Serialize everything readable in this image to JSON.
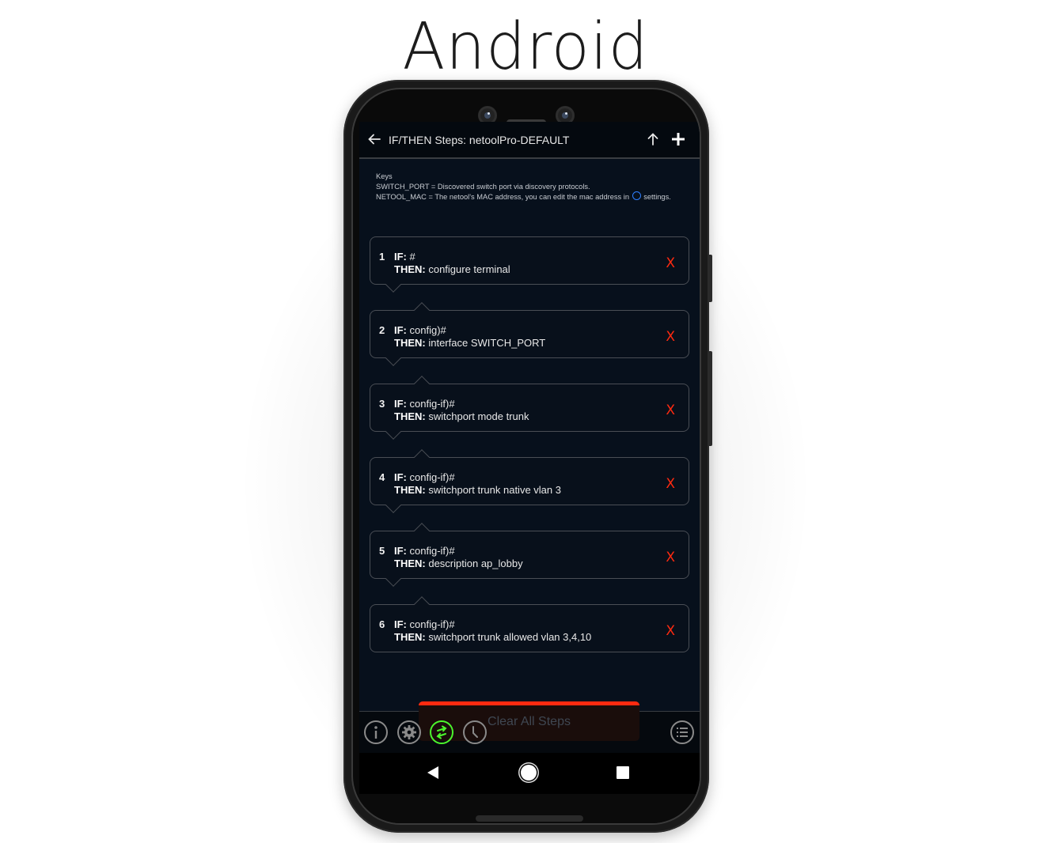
{
  "headline": "Android",
  "app": {
    "title": "IF/THEN Steps: netoolPro-DEFAULT",
    "icons": {
      "back": "arrow-left-icon",
      "upload": "arrow-up-icon",
      "add": "plus-icon"
    }
  },
  "keys": {
    "heading": "Keys",
    "switch_port": "SWITCH_PORT = Discovered switch port via discovery protocols.",
    "netool_mac_prefix": "NETOOL_MAC = The netool's MAC address, you can edit the mac address in",
    "netool_mac_suffix": "settings."
  },
  "steps": [
    {
      "num": "1",
      "if_label": "IF:",
      "if_value": "#",
      "then_label": "THEN:",
      "then_value": "configure terminal",
      "delete": "X"
    },
    {
      "num": "2",
      "if_label": "IF:",
      "if_value": "config)#",
      "then_label": "THEN:",
      "then_value": "interface SWITCH_PORT",
      "delete": "X"
    },
    {
      "num": "3",
      "if_label": "IF:",
      "if_value": "config-if)#",
      "then_label": "THEN:",
      "then_value": "switchport mode trunk",
      "delete": "X"
    },
    {
      "num": "4",
      "if_label": "IF:",
      "if_value": "config-if)#",
      "then_label": "THEN:",
      "then_value": "switchport trunk native vlan 3",
      "delete": "X"
    },
    {
      "num": "5",
      "if_label": "IF:",
      "if_value": "config-if)#",
      "then_label": "THEN:",
      "then_value": "description ap_lobby",
      "delete": "X"
    },
    {
      "num": "6",
      "if_label": "IF:",
      "if_value": "config-if)#",
      "then_label": "THEN:",
      "then_value": "switchport trunk allowed vlan 3,4,10",
      "delete": "X"
    }
  ],
  "clear_button": "Clear All Steps",
  "toolbar": {
    "items": [
      {
        "icon": "info-icon"
      },
      {
        "icon": "gear-icon"
      },
      {
        "icon": "swap-arrows-icon",
        "active": true
      },
      {
        "icon": "clock-icon"
      },
      {
        "icon": "list-icon"
      }
    ]
  },
  "colors": {
    "accent_green": "#4cf52d",
    "delete_red": "#ff2a10",
    "screen_bg": "#07101c"
  }
}
